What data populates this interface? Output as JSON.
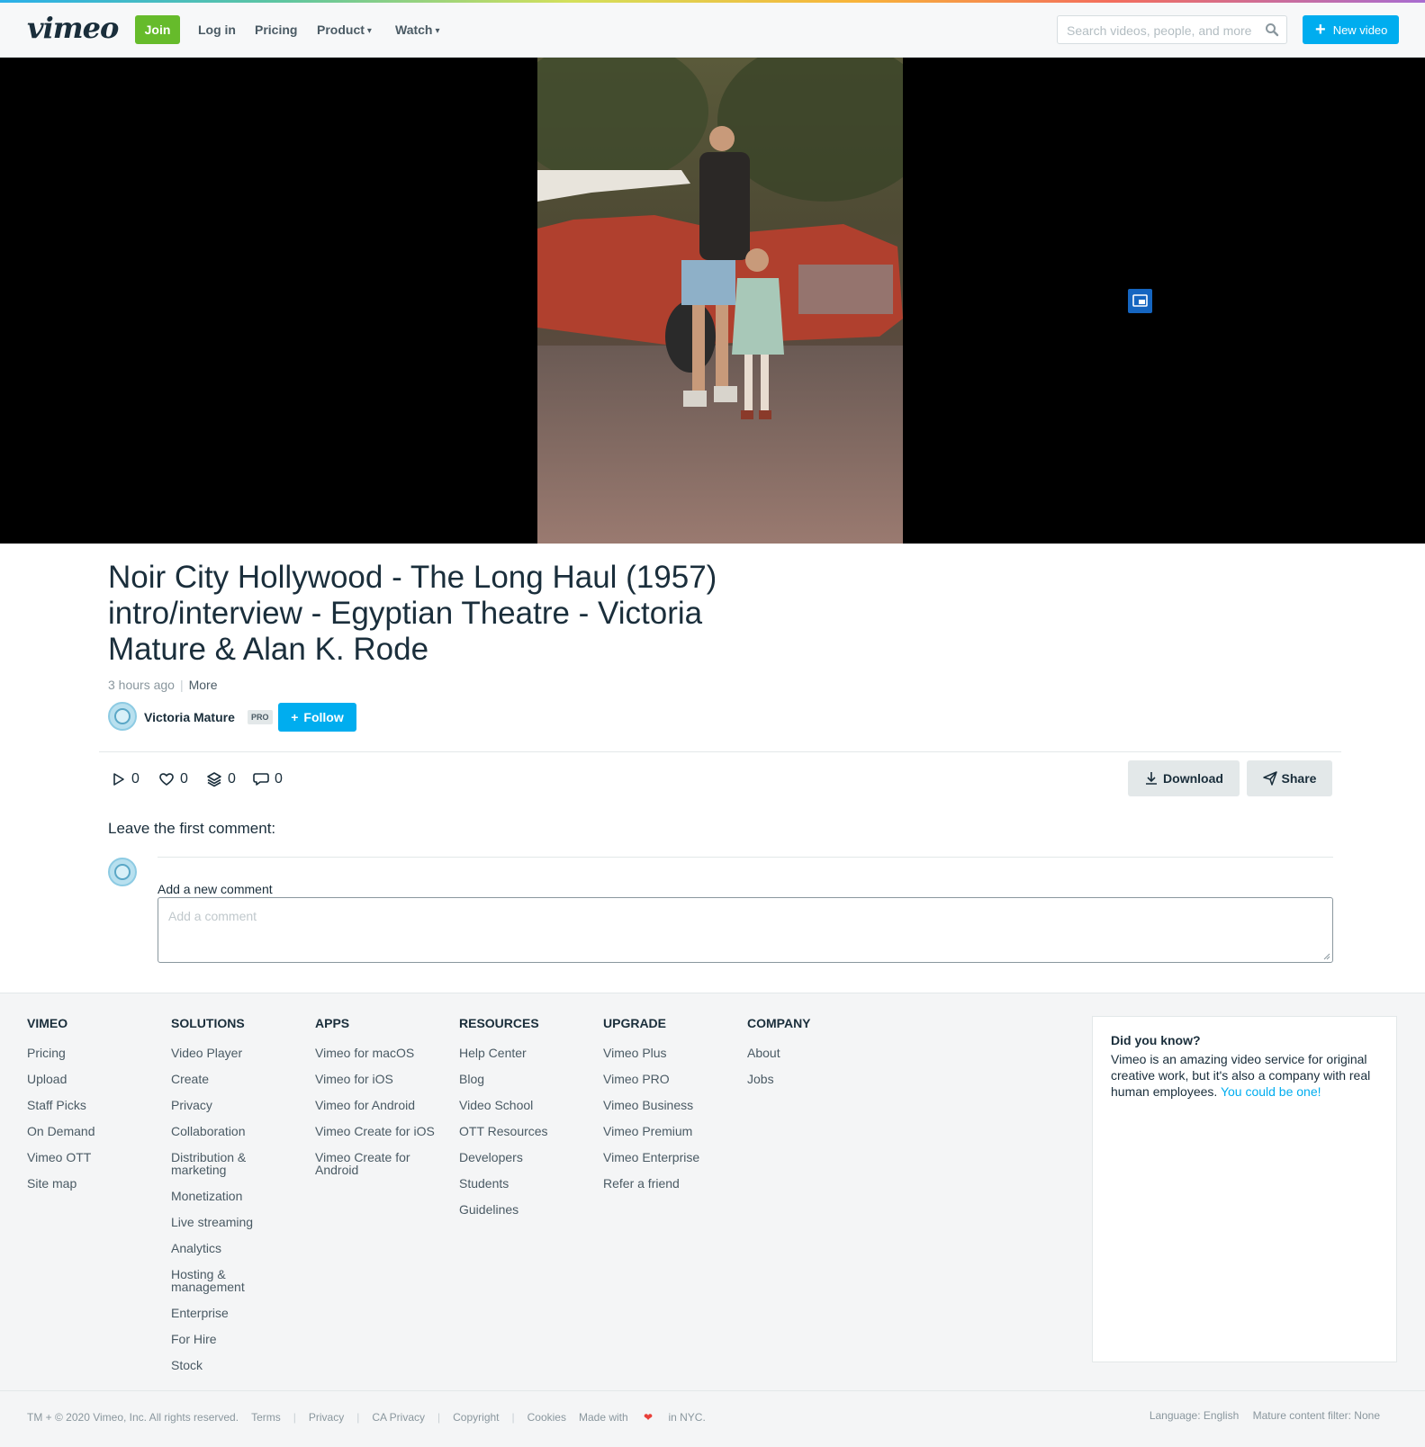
{
  "header": {
    "logo": "vimeo",
    "join_label": "Join",
    "nav": [
      {
        "label": "Log in"
      },
      {
        "label": "Pricing"
      },
      {
        "label": "Product"
      },
      {
        "label": "Watch"
      }
    ],
    "search_placeholder": "Search videos, people, and more",
    "new_video_label": "New video"
  },
  "video": {
    "title": "Noir City Hollywood - The Long Haul (1957) intro/interview - Egyptian Theatre - Victoria Mature & Alan K. Rode",
    "posted": "3 hours ago",
    "more_label": "More",
    "author": "Victoria Mature",
    "author_badge": "PRO",
    "follow_label": "Follow",
    "stats": {
      "plays": "0",
      "likes": "0",
      "collections": "0",
      "comments": "0"
    },
    "download_label": "Download",
    "share_label": "Share"
  },
  "comments": {
    "heading": "Leave the first comment:",
    "add_label": "Add a new comment",
    "placeholder": "Add a comment"
  },
  "footer": {
    "columns": [
      {
        "title": "VIMEO",
        "links": [
          "Pricing",
          "Upload",
          "Staff Picks",
          "On Demand",
          "Vimeo OTT",
          "Site map"
        ]
      },
      {
        "title": "SOLUTIONS",
        "links": [
          "Video Player",
          "Create",
          "Privacy",
          "Collaboration",
          "Distribution & marketing",
          "Monetization",
          "Live streaming",
          "Analytics",
          "Hosting & management",
          "Enterprise",
          "For Hire",
          "Stock"
        ]
      },
      {
        "title": "APPS",
        "links": [
          "Vimeo for macOS",
          "Vimeo for iOS",
          "Vimeo for Android",
          "Vimeo Create for iOS",
          "Vimeo Create for Android"
        ]
      },
      {
        "title": "RESOURCES",
        "links": [
          "Help Center",
          "Blog",
          "Video School",
          "OTT Resources",
          "Developers",
          "Students",
          "Guidelines"
        ]
      },
      {
        "title": "UPGRADE",
        "links": [
          "Vimeo Plus",
          "Vimeo PRO",
          "Vimeo Business",
          "Vimeo Premium",
          "Vimeo Enterprise",
          "Refer a friend"
        ]
      },
      {
        "title": "COMPANY",
        "links": [
          "About",
          "Jobs"
        ]
      }
    ],
    "did_you_know": {
      "title": "Did you know?",
      "text": "Vimeo is an amazing video service for original creative work, but it's also a company with real human employees.",
      "link": "You could be one!"
    },
    "bottom": {
      "copyright": "TM + © 2020 Vimeo, Inc. All rights reserved.",
      "links": [
        "Terms",
        "Privacy",
        "CA Privacy",
        "Copyright",
        "Cookies"
      ],
      "made_with_prefix": "Made with",
      "made_with_suffix": "in NYC.",
      "language": "Language: English",
      "mature_filter": "Mature content filter: None"
    }
  },
  "colors": {
    "brand_blue": "#00adef",
    "join_green": "#66bb2b",
    "text_dark": "#1a2e3b"
  }
}
